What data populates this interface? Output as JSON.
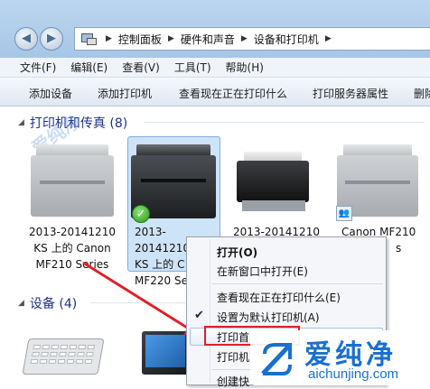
{
  "breadcrumb": {
    "items": [
      "控制面板",
      "硬件和声音",
      "设备和打印机"
    ]
  },
  "menu": [
    "文件(F)",
    "编辑(E)",
    "查看(V)",
    "工具(T)",
    "帮助(H)"
  ],
  "toolbar": [
    "添加设备",
    "添加打印机",
    "查看现在正在打印什么",
    "打印服务器属性",
    "删除"
  ],
  "printers_group": {
    "title": "打印机和传真 (8)"
  },
  "devices_group": {
    "title": "设备 (4)"
  },
  "printers": [
    {
      "line1": "2013-20141210",
      "line2": "KS 上的 Canon",
      "line3": "MF210 Series"
    },
    {
      "line1": "2013-20141210",
      "line2": "KS 上的 C",
      "line3": "MF220 Se"
    },
    {
      "line1": "2013-20141210",
      "line2": "",
      "line3": ""
    },
    {
      "line1": "Canon MF210",
      "line2": "s",
      "line3": ""
    }
  ],
  "context_menu": {
    "items": [
      "打开(O)",
      "在新窗口中打开(E)",
      "查看现在正在打印什么(E)",
      "设置为默认打印机(A)",
      "打印首",
      "打印机",
      "创建快"
    ]
  },
  "watermark": {
    "text": "爱纯净",
    "url": "aichunjing.com",
    "faint_text": "爱纯净"
  },
  "colors": {
    "highlight_box": "#e0202a",
    "selection": "#cde3f7",
    "arrow": "#e0202a"
  }
}
